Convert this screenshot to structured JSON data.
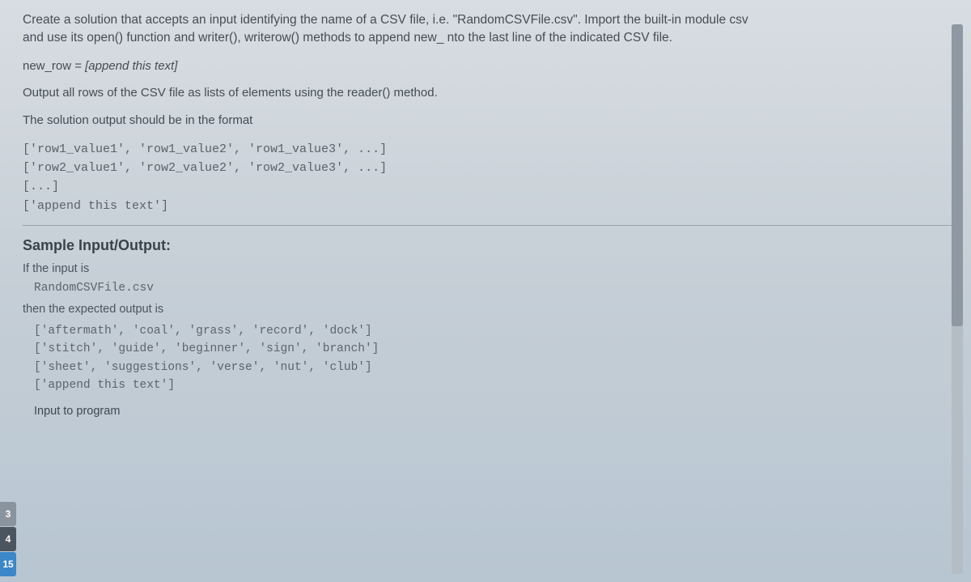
{
  "intro_line1": "Create a solution that accepts an input identifying the name of a CSV file, i.e. \"RandomCSVFile.csv\". Import the built-in module csv",
  "intro_line2": "and use its open() function and writer(), writerow() methods to append new_     nto the last line of the indicated CSV file.",
  "var_assign_left": "new_row = ",
  "var_assign_right": "[append this text]",
  "output_desc": "Output all rows of the CSV file as lists of elements using the reader() method.",
  "format_desc": "The solution output should be in the format",
  "format_block": "['row1_value1', 'row1_value2', 'row1_value3', ...]\n['row2_value1', 'row2_value2', 'row2_value3', ...]\n[...]\n['append this text']",
  "sample_heading": "Sample Input/Output:",
  "if_input": "If the input is",
  "sample_input": "RandomCSVFile.csv",
  "then_expected": "then the expected output is",
  "sample_output": "['aftermath', 'coal', 'grass', 'record', 'dock']\n['stitch', 'guide', 'beginner', 'sign', 'branch']\n['sheet', 'suggestions', 'verse', 'nut', 'club']\n['append this text']",
  "input_to_program": "Input to program",
  "tabs": {
    "t1": "3",
    "t2": "4",
    "t3": "15"
  }
}
